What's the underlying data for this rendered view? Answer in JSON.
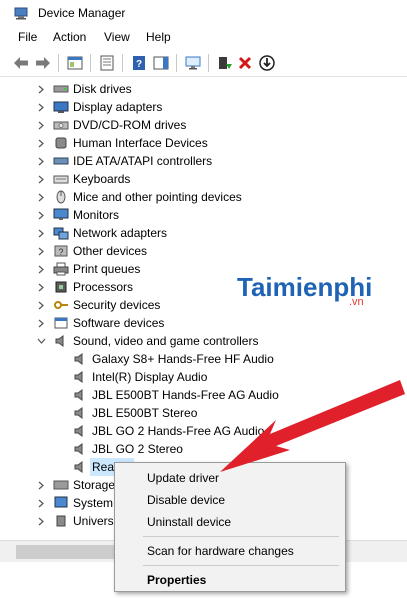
{
  "window": {
    "title": "Device Manager"
  },
  "menu": {
    "items": [
      "File",
      "Action",
      "View",
      "Help"
    ]
  },
  "tree": {
    "categories": [
      "Disk drives",
      "Display adapters",
      "DVD/CD-ROM drives",
      "Human Interface Devices",
      "IDE ATA/ATAPI controllers",
      "Keyboards",
      "Mice and other pointing devices",
      "Monitors",
      "Network adapters",
      "Other devices",
      "Print queues",
      "Processors",
      "Security devices",
      "Software devices",
      "Sound, video and game controllers"
    ],
    "sound_children": [
      "Galaxy S8+ Hands-Free HF Audio",
      "Intel(R) Display Audio",
      "JBL E500BT Hands-Free AG Audio",
      "JBL E500BT Stereo",
      "JBL GO 2 Hands-Free AG Audio",
      "JBL GO 2 Stereo",
      "Rea"
    ],
    "after_categories": [
      "Storage",
      "System",
      "Univers"
    ]
  },
  "context_menu": {
    "update": "Update driver",
    "disable": "Disable device",
    "uninstall": "Uninstall device",
    "scan": "Scan for hardware changes",
    "properties": "Properties"
  },
  "watermark": {
    "brand": "Taimienphi",
    "tld": ".vn"
  },
  "colors": {
    "accent": "#1f63b5",
    "selection": "#cce8ff",
    "arrow": "#e0202a"
  }
}
